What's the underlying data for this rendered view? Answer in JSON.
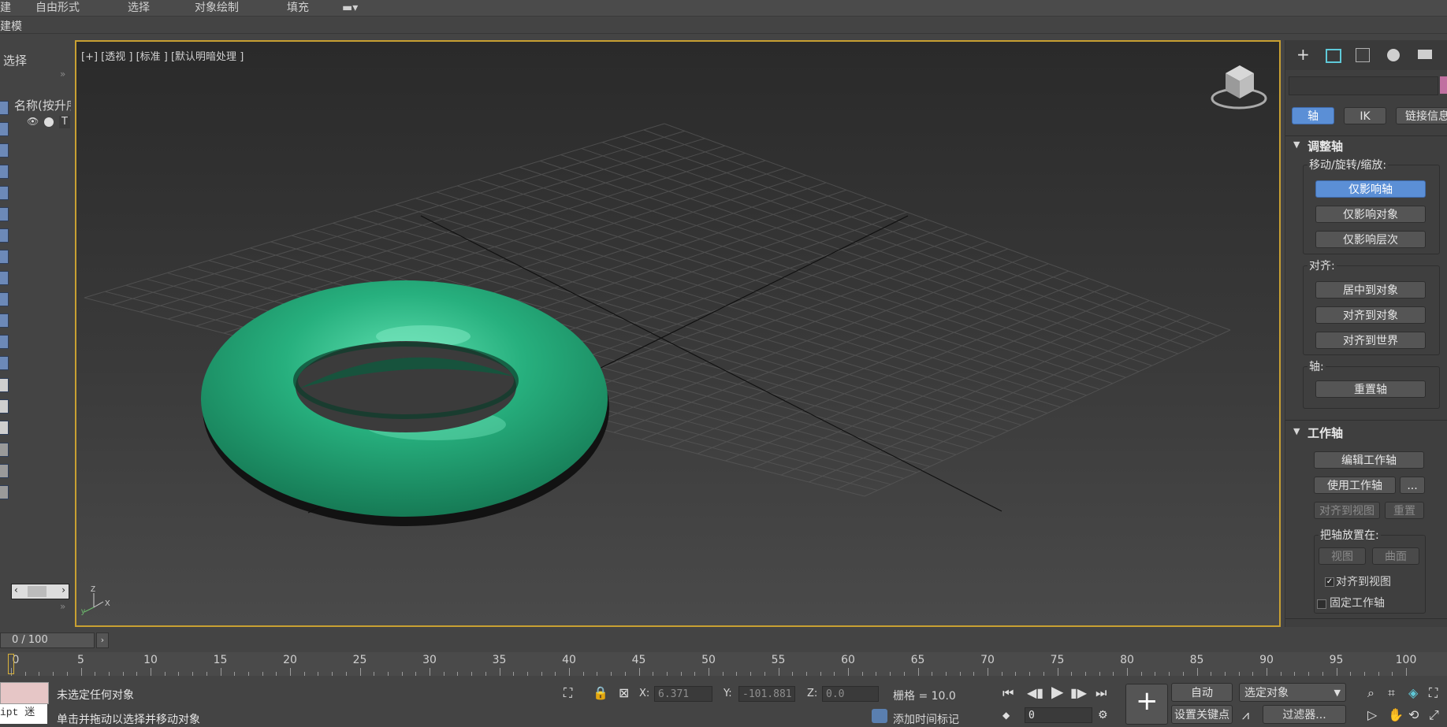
{
  "menu": [
    "建",
    "自由形式",
    "选择",
    "对象绘制",
    "填充"
  ],
  "ribbon_tab": "建模",
  "explorer": {
    "title": "选择",
    "column_header": "名称(按升序)",
    "row_label": "T"
  },
  "viewport": {
    "label": "[+] [透视 ] [标准 ] [默认明暗处理 ]",
    "axis_labels": {
      "z": "Z",
      "x": "X",
      "y": "y"
    },
    "object_color": "#27b07e"
  },
  "command_panel": {
    "tabs": [
      "create-icon",
      "modify-icon",
      "hierarchy-icon",
      "motion-icon",
      "display-icon"
    ],
    "subtabs": [
      "轴",
      "IK",
      "链接信息"
    ],
    "adjust_pivot": {
      "title": "调整轴",
      "move_group_label": "移动/旋转/缩放:",
      "buttons": [
        "仅影响轴",
        "仅影响对象",
        "仅影响层次"
      ],
      "align_label": "对齐:",
      "align_buttons": [
        "居中到对象",
        "对齐到对象",
        "对齐到世界"
      ],
      "pivot_label": "轴:",
      "reset_button": "重置轴"
    },
    "working_pivot": {
      "title": "工作轴",
      "edit_button": "编辑工作轴",
      "use_button": "使用工作轴",
      "more_button": "...",
      "align_view_button": "对齐到视图",
      "reset_button": "重置",
      "place_label": "把轴放置在:",
      "view_button": "视图",
      "surface_button": "曲面",
      "align_to_view_check": "对齐到视图",
      "fix_pivot_check": "固定工作轴"
    }
  },
  "timeline": {
    "frame_display": "0 / 100",
    "ticks": [
      "0",
      "5",
      "10",
      "15",
      "20",
      "25",
      "30",
      "35",
      "40",
      "45",
      "50",
      "55",
      "60",
      "65",
      "70",
      "75",
      "80",
      "85",
      "90",
      "95",
      "100"
    ]
  },
  "status": {
    "script_text": "ipt 迷",
    "line1": "未选定任何对象",
    "line2": "单击并拖动以选择并移动对象",
    "x_label": "X:",
    "x_value": "6.371",
    "y_label": "Y:",
    "y_value": "-101.881",
    "z_label": "Z:",
    "z_value": "0.0",
    "grid": "栅格 = 10.0",
    "add_time_tag": "添加时间标记",
    "auto_button": "自动",
    "set_key_button": "设置关键点",
    "selection_dropdown": "选定对象",
    "filter_button": "过滤器...",
    "frame_value": "0"
  }
}
